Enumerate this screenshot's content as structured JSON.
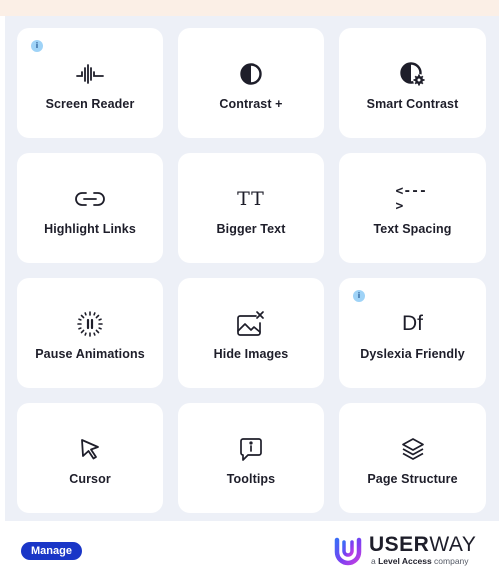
{
  "colors": {
    "panel_bg": "#edf0f7",
    "tile_bg": "#ffffff",
    "info_badge": "#9fd3f7",
    "manage_button": "#1a36c7",
    "top_strip": "#fbefe6"
  },
  "tiles": [
    {
      "label": "Screen Reader",
      "icon": "sound-wave-icon",
      "info": "i"
    },
    {
      "label": "Contrast +",
      "icon": "half-circle-contrast-icon"
    },
    {
      "label": "Smart Contrast",
      "icon": "smart-contrast-gear-icon"
    },
    {
      "label": "Highlight Links",
      "icon": "link-icon"
    },
    {
      "label": "Bigger Text",
      "icon": "text-size-icon",
      "glyph": "TT"
    },
    {
      "label": "Text Spacing",
      "icon": "text-spacing-arrows-icon",
      "glyph": "<--->"
    },
    {
      "label": "Pause Animations",
      "icon": "pause-animation-icon"
    },
    {
      "label": "Hide Images",
      "icon": "hide-image-icon"
    },
    {
      "label": "Dyslexia Friendly",
      "icon": "dyslexia-font-icon",
      "glyph": "Df",
      "info": "i"
    },
    {
      "label": "Cursor",
      "icon": "cursor-arrow-icon"
    },
    {
      "label": "Tooltips",
      "icon": "tooltip-icon"
    },
    {
      "label": "Page Structure",
      "icon": "layers-icon"
    }
  ],
  "footer": {
    "manage_label": "Manage",
    "brand_bold": "USER",
    "brand_rest": "WAY",
    "tagline_prefix": "a",
    "tagline_bold": "Level Access",
    "tagline_suffix": "company"
  }
}
